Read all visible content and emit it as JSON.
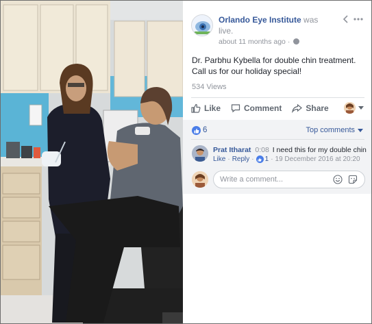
{
  "post": {
    "page_name": "Orlando Eye Institute",
    "was_live_prefix": "was",
    "was_live_suffix": "live.",
    "time_ago": "about 11 months ago",
    "meta_separator": "·",
    "text": "Dr. Parbhu Kybella for double chin treatment. Call us for our holiday special!",
    "views": "534 Views"
  },
  "actions": {
    "like_label": "Like",
    "comment_label": "Comment",
    "share_label": "Share"
  },
  "reactions": {
    "count": "6",
    "sort_label": "Top comments"
  },
  "comment": {
    "author": "Prat Itharat",
    "timestamp": "0:08",
    "text": "I need this for my double chin",
    "like_action": "Like",
    "reply_action": "Reply",
    "likes": "1",
    "separator": "·",
    "date": "19 December 2016 at 20:20"
  },
  "composer": {
    "placeholder": "Write a comment..."
  },
  "icons": {
    "back": "chevron-left-icon",
    "more": "more-dots-icon",
    "privacy": "globe-icon",
    "like": "thumbs-up-icon",
    "comment": "speech-bubble-icon",
    "share": "share-arrow-icon",
    "emoji": "smiley-icon",
    "sticker": "sticker-icon"
  },
  "colors": {
    "link_blue": "#365899",
    "reaction_blue": "#4a7de8",
    "muted_gray": "#90949c",
    "comment_bg": "#f2f3f5"
  }
}
